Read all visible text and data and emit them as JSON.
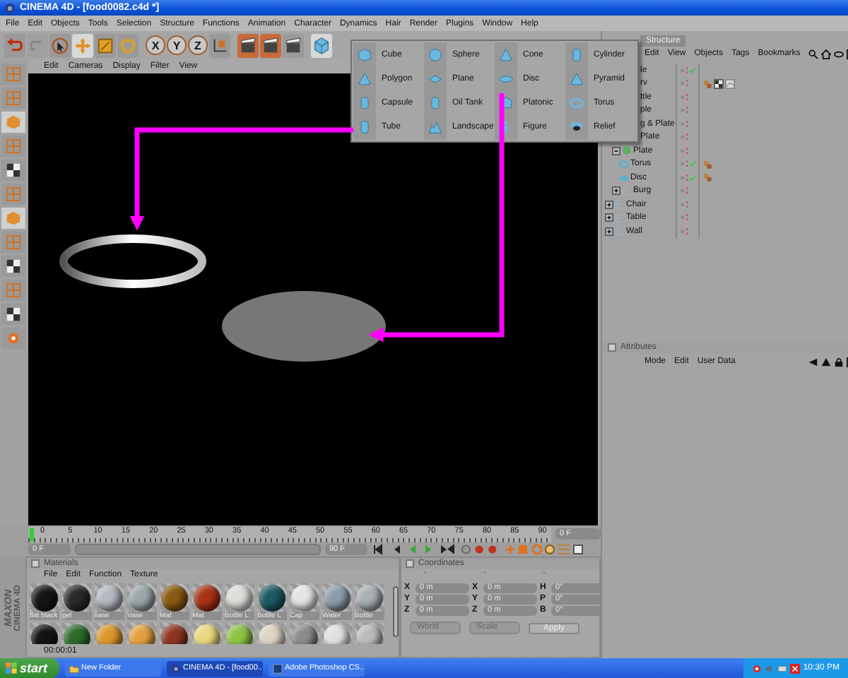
{
  "window": {
    "title": "CINEMA 4D - [food0082.c4d *]"
  },
  "menu_bar": [
    "File",
    "Edit",
    "Objects",
    "Tools",
    "Selection",
    "Structure",
    "Functions",
    "Animation",
    "Character",
    "Dynamics",
    "Hair",
    "Render",
    "Plugins",
    "Window",
    "Help"
  ],
  "toolbar": {
    "tools": [
      {
        "kind": "select",
        "selected": false
      },
      {
        "kind": "move",
        "selected": true
      },
      {
        "kind": "scale",
        "selected": false
      },
      {
        "kind": "rotate",
        "selected": false
      }
    ],
    "axes": [
      "X",
      "Y",
      "Z"
    ]
  },
  "viewport": {
    "menu": [
      "Edit",
      "Cameras",
      "Display",
      "Filter",
      "View"
    ]
  },
  "primitives_menu": [
    {
      "label": "Cube",
      "kind": "cube"
    },
    {
      "label": "Sphere",
      "kind": "sphere"
    },
    {
      "label": "Cone",
      "kind": "cone"
    },
    {
      "label": "Cylinder",
      "kind": "cylinder"
    },
    {
      "label": "Polygon",
      "kind": "polygon"
    },
    {
      "label": "Plane",
      "kind": "plane"
    },
    {
      "label": "Disc",
      "kind": "disc"
    },
    {
      "label": "Pyramid",
      "kind": "pyramid"
    },
    {
      "label": "Capsule",
      "kind": "capsule"
    },
    {
      "label": "Oil Tank",
      "kind": "oiltank"
    },
    {
      "label": "Platonic",
      "kind": "platonic"
    },
    {
      "label": "Torus",
      "kind": "torus"
    },
    {
      "label": "Tube",
      "kind": "tube"
    },
    {
      "label": "Landscape",
      "kind": "landscape"
    },
    {
      "label": "Figure",
      "kind": "figure"
    },
    {
      "label": "Relief",
      "kind": "relief"
    }
  ],
  "object_manager": {
    "tab": "Structure",
    "menu": [
      "Edit",
      "View",
      "Objects",
      "Tags",
      "Bookmarks"
    ],
    "tree": [
      {
        "name": "le",
        "check": true
      },
      {
        "name": "rv",
        "check": false,
        "tags": [
          {
            "kind": "phong"
          },
          {
            "kind": "checker"
          },
          {
            "kind": "texture"
          }
        ]
      },
      {
        "name": "ttle",
        "check": false
      },
      {
        "name": "ple",
        "check": false
      },
      {
        "name": "g & Plate",
        "check": false
      },
      {
        "name": "Plate",
        "check": false,
        "children": [
          {
            "name": "Plate",
            "kind": "sphere",
            "expanded": true,
            "check": false,
            "children": [
              {
                "name": "Torus",
                "kind": "torus",
                "check": true,
                "tags": [
                  {
                    "kind": "phong"
                  }
                ]
              },
              {
                "name": "Disc",
                "kind": "disc",
                "check": true,
                "tags": [
                  {
                    "kind": "phong"
                  }
                ]
              }
            ]
          },
          {
            "name": "Burg",
            "kind": "null",
            "expanded": false,
            "check": false
          }
        ]
      },
      {
        "name": "Chair",
        "kind": "null",
        "expanded": false,
        "check": false
      },
      {
        "name": "Table",
        "kind": "null",
        "expanded": false,
        "check": false
      },
      {
        "name": "Wall",
        "kind": "null",
        "expanded": false,
        "check": false
      }
    ]
  },
  "attributes": {
    "title": "Attributes",
    "menu": [
      "Mode",
      "Edit",
      "User Data"
    ]
  },
  "timeline": {
    "ticks": [
      "0",
      "5",
      "10",
      "15",
      "20",
      "25",
      "30",
      "35",
      "40",
      "45",
      "50",
      "55",
      "60",
      "65",
      "70",
      "75",
      "80",
      "85",
      "90"
    ],
    "level": 0,
    "current": "0 F",
    "start": "0 F",
    "end": "90 F"
  },
  "materials": {
    "title": "Materials",
    "menu": [
      "File",
      "Edit",
      "Function",
      "Texture"
    ],
    "items": [
      {
        "name": "flat black",
        "color": "#161616"
      },
      {
        "name": "gel",
        "color": "#2a2a2a"
      },
      {
        "name": "liase",
        "color": "#b4b8c0"
      },
      {
        "name": "Vase",
        "color": "#9aa6aa"
      },
      {
        "name": "Mat",
        "color": "#8a5a12"
      },
      {
        "name": "Mat",
        "color": "#a83214"
      },
      {
        "name": "Bottle L",
        "color": "#dcdcd8"
      },
      {
        "name": "Bottle L",
        "color": "#1c5a62"
      },
      {
        "name": "Cap",
        "color": "#e4e4e4"
      },
      {
        "name": "Water",
        "color": "#8c9cac"
      },
      {
        "name": "Bottle",
        "color": "#a8b0b4"
      },
      {
        "color": "#141414"
      },
      {
        "color": "#2c6a2c"
      },
      {
        "color": "#dc962e"
      },
      {
        "color": "#e4a040"
      },
      {
        "color": "#8c3420"
      },
      {
        "color": "#e8d87c"
      },
      {
        "color": "#8cc444"
      },
      {
        "color": "#dcd4c4"
      },
      {
        "color": "#8c8c8c"
      },
      {
        "color": "#e0e0e0"
      },
      {
        "color": "#bcbcbc"
      }
    ],
    "time": "00:00:01"
  },
  "coordinates": {
    "title": "Coordinates",
    "headers": [
      "-",
      "-",
      "-"
    ],
    "columns": [
      [
        {
          "axis": "X",
          "value": "0 m"
        },
        {
          "axis": "Y",
          "value": "0 m"
        },
        {
          "axis": "Z",
          "value": "0 m"
        }
      ],
      [
        {
          "axis": "X",
          "value": "0 m"
        },
        {
          "axis": "Y",
          "value": "0 m"
        },
        {
          "axis": "Z",
          "value": "0 m"
        }
      ],
      [
        {
          "axis": "H",
          "value": "0°"
        },
        {
          "axis": "P",
          "value": "0°"
        },
        {
          "axis": "B",
          "value": "0°"
        }
      ]
    ],
    "dropdowns": [
      "World",
      "Scale"
    ],
    "apply": "Apply"
  },
  "logo": {
    "brand": "MAXON",
    "product": "CINEMA 4D"
  },
  "taskbar": {
    "start": "start",
    "tasks": [
      {
        "label": "New Folder",
        "kind": "folder",
        "selected": false
      },
      {
        "label": "CINEMA 4D - [food00...",
        "kind": "cinema",
        "selected": true
      },
      {
        "label": "Adobe Photoshop CS...",
        "kind": "photoshop",
        "selected": false
      }
    ],
    "clock": "10:30 PM"
  }
}
